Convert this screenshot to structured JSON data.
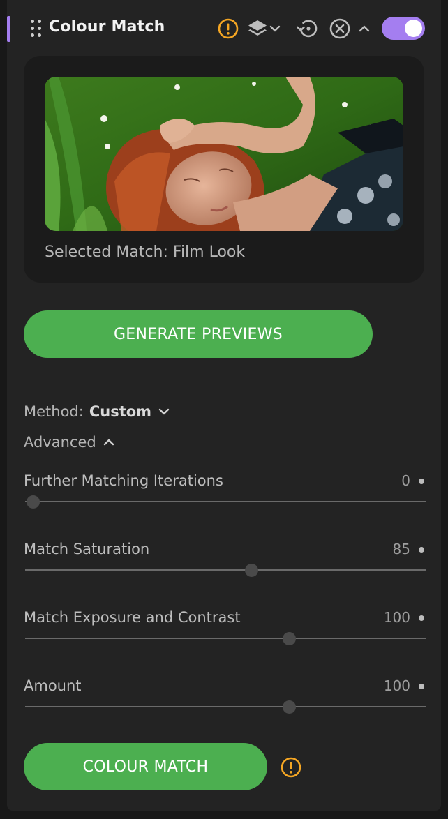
{
  "header": {
    "title": "Colour Match",
    "enabled": true,
    "icons": [
      "warning-icon",
      "layers-icon",
      "chevron-down-icon",
      "reset-icon",
      "remove-icon",
      "chevron-up-icon"
    ]
  },
  "preview": {
    "caption": "Selected Match: Film Look"
  },
  "generate_button": {
    "label": "GENERATE PREVIEWS"
  },
  "method": {
    "label": "Method:",
    "value": "Custom"
  },
  "advanced": {
    "label": "Advanced",
    "expanded": true
  },
  "sliders": [
    {
      "label": "Further Matching Iterations",
      "value": "0",
      "position": 0.02
    },
    {
      "label": "Match Saturation",
      "value": "85",
      "position": 0.565
    },
    {
      "label": "Match Exposure and Contrast",
      "value": "100",
      "position": 0.659
    },
    {
      "label": "Amount",
      "value": "100",
      "position": 0.659
    }
  ],
  "colour_match_button": {
    "label": "COLOUR MATCH"
  },
  "colors": {
    "accent": "#a47ef0",
    "button_green": "#4caf50",
    "warning": "#f5a623",
    "panel_bg": "#232323"
  }
}
